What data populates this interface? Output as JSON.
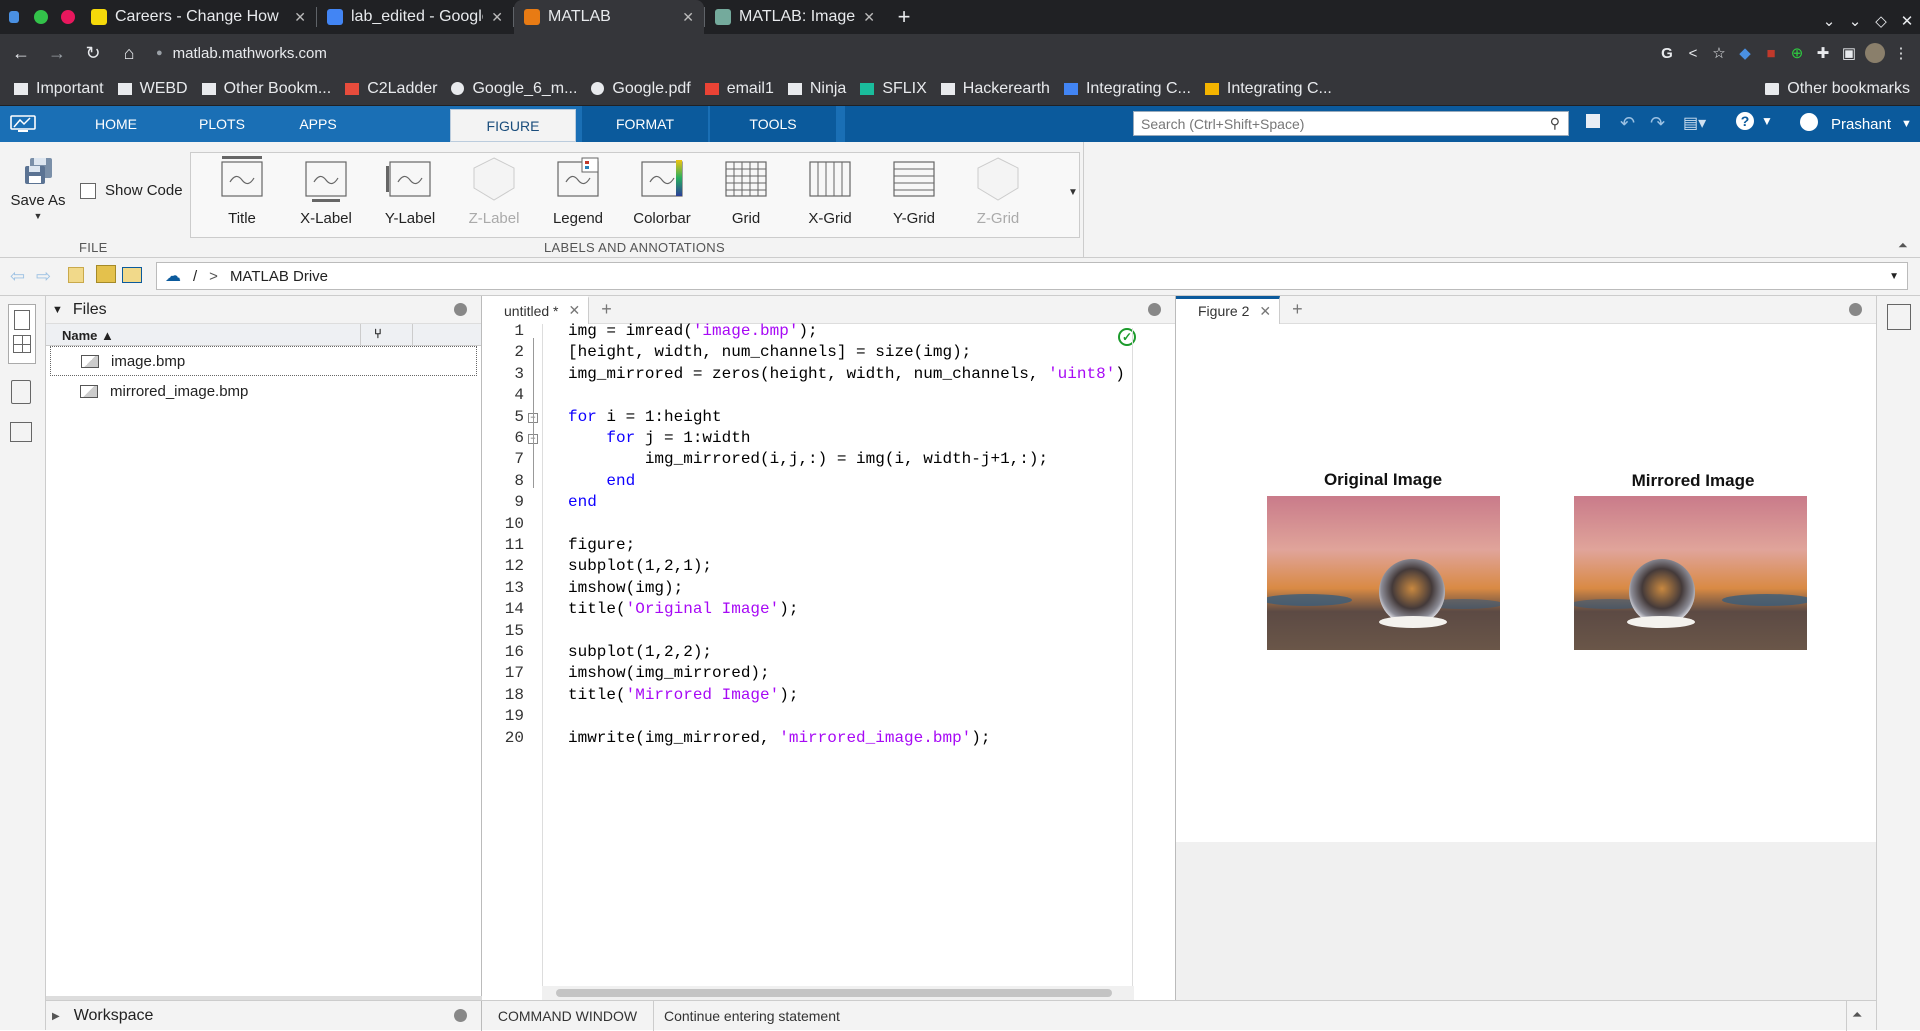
{
  "browser": {
    "tabs": [
      {
        "title": "Careers - Change How",
        "active": false,
        "favicon_color": "#f5d90a"
      },
      {
        "title": "lab_edited - Google Do",
        "active": false,
        "favicon_color": "#4285f4"
      },
      {
        "title": "MATLAB",
        "active": true,
        "favicon_color": "#e87b14"
      },
      {
        "title": "MATLAB: Image Mirrori",
        "active": false,
        "favicon_color": "#74aa9c"
      }
    ],
    "new_tab": "+",
    "url": "matlab.mathworks.com",
    "bookmarks": [
      {
        "label": "Important",
        "icon": "folder-icon"
      },
      {
        "label": "WEBD",
        "icon": "folder-icon"
      },
      {
        "label": "Other Bookm...",
        "icon": "folder-icon"
      },
      {
        "label": "C2Ladder",
        "icon": "chart-icon"
      },
      {
        "label": "Google_6_m...",
        "icon": "globe-icon"
      },
      {
        "label": "Google.pdf",
        "icon": "globe-icon"
      },
      {
        "label": "email1",
        "icon": "gmail-icon"
      },
      {
        "label": "Ninja",
        "icon": "folder-icon"
      },
      {
        "label": "SFLIX",
        "icon": "s-icon"
      },
      {
        "label": "Hackerearth",
        "icon": "folder-icon"
      },
      {
        "label": "Integrating C...",
        "icon": "doc-icon"
      },
      {
        "label": "Integrating C...",
        "icon": "slides-icon"
      }
    ],
    "other_bookmarks": "Other bookmarks"
  },
  "matlab": {
    "ribbon_tabs": [
      "HOME",
      "PLOTS",
      "APPS",
      "FIGURE",
      "FORMAT",
      "TOOLS"
    ],
    "active_tab": "FIGURE",
    "search_placeholder": "Search (Ctrl+Shift+Space)",
    "user": "Prashant",
    "file_group": {
      "save_as": "Save As",
      "show_code": "Show Code",
      "label": "FILE"
    },
    "annotations_group": {
      "label": "LABELS AND ANNOTATIONS",
      "buttons": [
        {
          "label": "Title",
          "enabled": true
        },
        {
          "label": "X-Label",
          "enabled": true
        },
        {
          "label": "Y-Label",
          "enabled": true
        },
        {
          "label": "Z-Label",
          "enabled": false
        },
        {
          "label": "Legend",
          "enabled": true
        },
        {
          "label": "Colorbar",
          "enabled": true
        },
        {
          "label": "Grid",
          "enabled": true
        },
        {
          "label": "X-Grid",
          "enabled": true
        },
        {
          "label": "Y-Grid",
          "enabled": true
        },
        {
          "label": "Z-Grid",
          "enabled": false
        }
      ]
    },
    "path": {
      "root": "/",
      "sep": ">",
      "folder": "MATLAB Drive"
    },
    "files_panel": {
      "title": "Files",
      "column": "Name",
      "files": [
        "image.bmp",
        "mirrored_image.bmp"
      ]
    },
    "editor": {
      "tab": "untitled *",
      "lines": [
        "img = imread('image.bmp');",
        "[height, width, num_channels] = size(img);",
        "img_mirrored = zeros(height, width, num_channels, 'uint8')",
        "",
        "for i = 1:height",
        "    for j = 1:width",
        "        img_mirrored(i,j,:) = img(i, width-j+1,:);",
        "    end",
        "end",
        "",
        "figure;",
        "subplot(1,2,1);",
        "imshow(img);",
        "title('Original Image');",
        "",
        "subplot(1,2,2);",
        "imshow(img_mirrored);",
        "title('Mirrored Image');",
        "",
        "imwrite(img_mirrored, 'mirrored_image.bmp');"
      ]
    },
    "figure": {
      "tab": "Figure 2",
      "left_title": "Original Image",
      "right_title": "Mirrored Image"
    },
    "workspace": "Workspace",
    "command_window": "COMMAND WINDOW",
    "status": "Continue entering statement"
  }
}
